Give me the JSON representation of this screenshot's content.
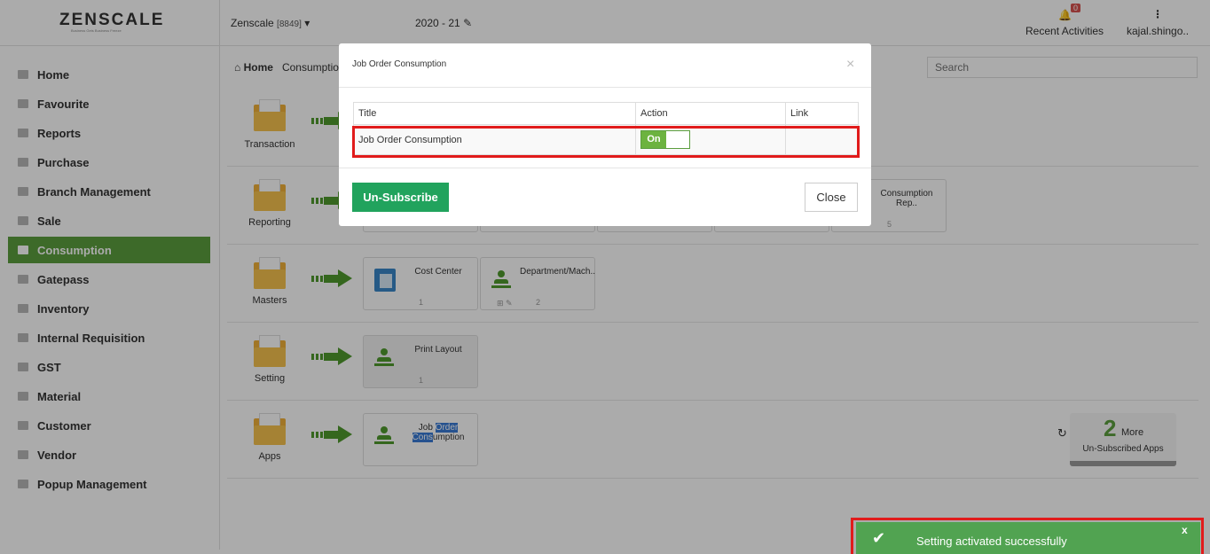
{
  "header": {
    "logo": "ZENSCALE",
    "logo_tagline": "Business Gets Business Freeze",
    "company": "Zenscale",
    "company_code": "[8849]",
    "year": "2020 - 21",
    "notifications_count": "0",
    "recent_activities": "Recent Activities",
    "user": "kajal.shingo.."
  },
  "sidebar": {
    "items": [
      {
        "label": "Home",
        "active": false
      },
      {
        "label": "Favourite",
        "active": false
      },
      {
        "label": "Reports",
        "active": false
      },
      {
        "label": "Purchase",
        "active": false
      },
      {
        "label": "Branch Management",
        "active": false
      },
      {
        "label": "Sale",
        "active": false
      },
      {
        "label": "Consumption",
        "active": true
      },
      {
        "label": "Gatepass",
        "active": false
      },
      {
        "label": "Inventory",
        "active": false
      },
      {
        "label": "Internal Requisition",
        "active": false
      },
      {
        "label": "GST",
        "active": false
      },
      {
        "label": "Material",
        "active": false
      },
      {
        "label": "Customer",
        "active": false
      },
      {
        "label": "Vendor",
        "active": false
      },
      {
        "label": "Popup Management",
        "active": false
      }
    ]
  },
  "breadcrumb": {
    "home": "Home",
    "current": "Consumptio"
  },
  "search": {
    "placeholder": "Search"
  },
  "rows": {
    "transaction": {
      "label": "Transaction"
    },
    "reporting": {
      "label": "Reporting",
      "tile_name": "Consumption Rep..",
      "tile_count": "5"
    },
    "masters": {
      "label": "Masters",
      "tiles": [
        {
          "name": "Cost Center",
          "count": "1"
        },
        {
          "name": "Department/Mach..",
          "count": "2"
        }
      ]
    },
    "setting": {
      "label": "Setting",
      "tile_name": "Print Layout",
      "tile_count": "1"
    },
    "apps": {
      "label": "Apps",
      "tile_name_1": "Job",
      "tile_name_2": "Order",
      "tile_name_3": "Cons",
      "tile_name_4": "umption"
    }
  },
  "more_apps": {
    "count": "2",
    "word": "More",
    "subtitle": "Un-Subscribed Apps"
  },
  "modal": {
    "title": "Job Order Consumption",
    "close_symbol": "×",
    "columns": [
      "Title",
      "Action",
      "Link"
    ],
    "row": {
      "title": "Job Order Consumption",
      "action": "On",
      "link": ""
    },
    "unsubscribe_label": "Un-Subscribe",
    "close_label": "Close"
  },
  "toast": {
    "message": "Setting activated successfully",
    "close_symbol": "x"
  }
}
